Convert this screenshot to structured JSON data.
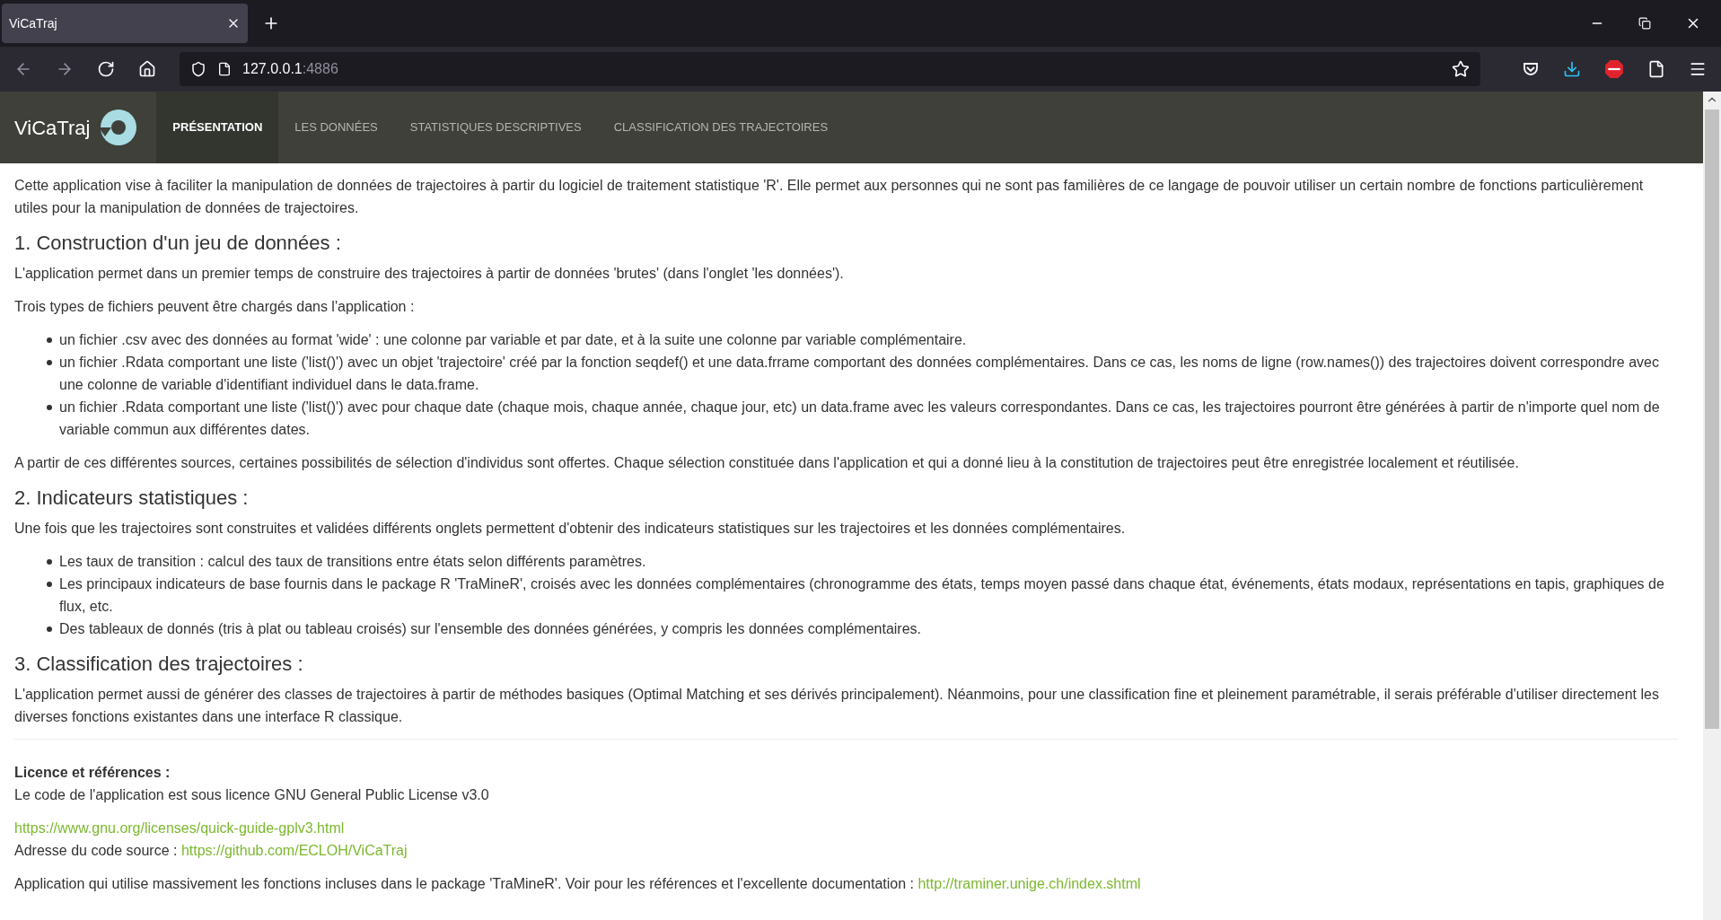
{
  "browser": {
    "tab_title": "ViCaTraj",
    "url_host": "127.0.0.1",
    "url_port": ":4886"
  },
  "navbar": {
    "brand": "ViCaTraj",
    "tabs": [
      {
        "label": "PRÉSENTATION",
        "selected": true
      },
      {
        "label": "LES DONNÉES",
        "selected": false
      },
      {
        "label": "STATISTIQUES DESCRIPTIVES",
        "selected": false
      },
      {
        "label": "CLASSIFICATION DES TRAJECTOIRES",
        "selected": false
      }
    ]
  },
  "content": [
    {
      "kind": "paragraph",
      "text": "Cette application vise à faciliter la manipulation de données de trajectoires à partir du logiciel de traitement statistique 'R'. Elle permet aux personnes qui ne sont pas familières de ce langage de pouvoir utiliser un certain nombre de fonctions particulièrement utiles pour la manipulation de données de trajectoires."
    },
    {
      "kind": "heading",
      "text": "1. Construction d'un jeu de données :"
    },
    {
      "kind": "paragraph",
      "text": "L'application permet dans un premier temps de construire des trajectoires à partir de données 'brutes' (dans l'onglet 'les données')."
    },
    {
      "kind": "paragraph",
      "text": "Trois types de fichiers peuvent être chargés dans l'application :"
    },
    {
      "kind": "list",
      "items": [
        "un fichier .csv avec des données au format 'wide' : une colonne par variable et par date, et à la suite une colonne par variable complémentaire.",
        "un fichier .Rdata comportant une liste ('list()') avec un objet 'trajectoire' créé par la fonction seqdef() et une data.frrame comportant des données complémentaires. Dans ce cas, les noms de ligne (row.names()) des trajectoires doivent correspondre avec une colonne de variable d'identifiant individuel dans le data.frame.",
        "un fichier .Rdata comportant une liste ('list()') avec pour chaque date (chaque mois, chaque année, chaque jour, etc) un data.frame avec les valeurs correspondantes. Dans ce cas, les trajectoires pourront être générées à partir de n'importe quel nom de variable commun aux différentes dates."
      ]
    },
    {
      "kind": "paragraph",
      "text": "A partir de ces différentes sources, certaines possibilités de sélection d'individus sont offertes. Chaque sélection constituée dans l'application et qui a donné lieu à la constitution de trajectoires peut être enregistrée localement et réutilisée."
    },
    {
      "kind": "heading",
      "text": "2. Indicateurs statistiques :"
    },
    {
      "kind": "paragraph",
      "text": "Une fois que les trajectoires sont construites et validées différents onglets permettent d'obtenir des indicateurs statistiques sur les trajectoires et les données complémentaires."
    },
    {
      "kind": "list",
      "items": [
        "Les taux de transition : calcul des taux de transitions entre états selon différents paramètres.",
        "Les principaux indicateurs de base fournis dans le package R 'TraMineR', croisés avec les données complémentaires (chronogramme des états, temps moyen passé dans chaque état, événements, états modaux, représentations en tapis, graphiques de flux, etc.",
        "Des tableaux de donnés (tris à plat ou tableau croisés) sur l'ensemble des données générées, y compris les données complémentaires."
      ]
    },
    {
      "kind": "heading",
      "text": "3. Classification des trajectoires :"
    },
    {
      "kind": "paragraph",
      "text": "L'application permet aussi de générer des classes de trajectoires à partir de méthodes basiques (Optimal Matching et ses dérivés principalement). Néanmoins, pour une classification fine et pleinement paramétrable, il serais préférable d'utiliser directement les diverses fonctions existantes dans une interface R classique."
    }
  ],
  "footer": {
    "licence_heading": "Licence et références :",
    "licence_text": "Le code de l'application est sous licence GNU General Public License v3.0",
    "gnu_link": "https://www.gnu.org/licenses/quick-guide-gplv3.html",
    "source_label": "Adresse du code source :",
    "source_link": "https://github.com/ECLOH/ViCaTraj",
    "traminer_text": "Application qui utilise massivement les fonctions incluses dans le package 'TraMineR'. Voir pour les références et l'excellente documentation :",
    "traminer_link": "http://traminer.unige.ch/index.shtml"
  }
}
